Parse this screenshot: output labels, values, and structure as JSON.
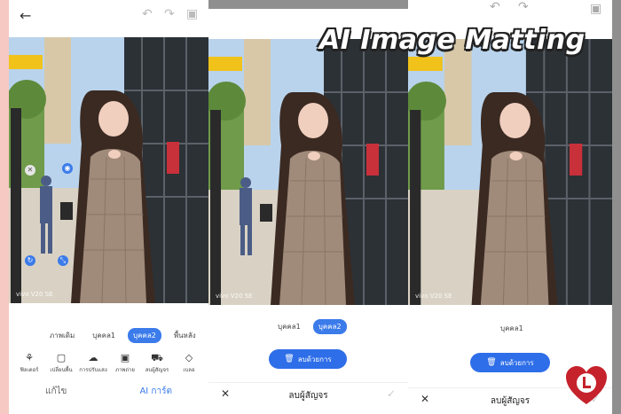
{
  "headline": "AI Image Matting",
  "photo": {
    "watermark": "vivo V20 SE"
  },
  "panel1": {
    "person_tabs": [
      "ภาพเดิม",
      "บุคคล1",
      "บุคคล2",
      "พื้นหลัง"
    ],
    "active_tab": 2,
    "tools": [
      {
        "label": "ฟิลเตอร์",
        "icon": "filter-icon"
      },
      {
        "label": "เปลี่ยนพื้น",
        "icon": "background-icon"
      },
      {
        "label": "การปรับแสง",
        "icon": "adjust-icon"
      },
      {
        "label": "ภาพถ่าย",
        "icon": "portrait-icon"
      },
      {
        "label": "ลบผู้สัญจร",
        "icon": "passerby-icon"
      },
      {
        "label": "เบลอ",
        "icon": "blur-icon"
      }
    ],
    "nav": {
      "edit": "แก้ไข",
      "ai": "AI การ์ต"
    }
  },
  "panel2": {
    "person_tabs": [
      "บุคคล1",
      "บุคคล2"
    ],
    "erase_label": "ลบด้วยการ",
    "footer_title": "ลบผู้สัญจร"
  },
  "panel3": {
    "person_tabs": [
      "บุคคล1"
    ],
    "erase_label": "ลบด้วยการ",
    "footer_title": "ลบผู้สัญจร"
  },
  "colors": {
    "accent": "#2e6ee8",
    "bg_left": "#f6c9c3",
    "bg_right": "#8f8f8f"
  }
}
